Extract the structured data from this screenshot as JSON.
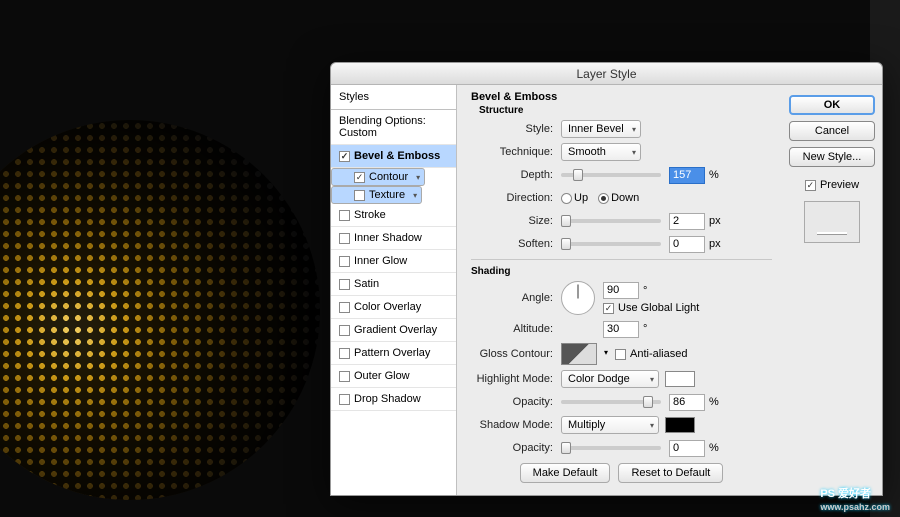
{
  "dialog": {
    "title": "Layer Style"
  },
  "styles_list": {
    "header": "Styles",
    "blending": "Blending Options: Custom",
    "items": [
      {
        "label": "Bevel & Emboss",
        "checked": true,
        "active": true
      },
      {
        "label": "Contour",
        "checked": true,
        "indent": true,
        "sel": true
      },
      {
        "label": "Texture",
        "checked": false,
        "indent": true,
        "sel": true
      },
      {
        "label": "Stroke",
        "checked": false
      },
      {
        "label": "Inner Shadow",
        "checked": false
      },
      {
        "label": "Inner Glow",
        "checked": false
      },
      {
        "label": "Satin",
        "checked": false
      },
      {
        "label": "Color Overlay",
        "checked": false
      },
      {
        "label": "Gradient Overlay",
        "checked": false
      },
      {
        "label": "Pattern Overlay",
        "checked": false
      },
      {
        "label": "Outer Glow",
        "checked": false
      },
      {
        "label": "Drop Shadow",
        "checked": false
      }
    ]
  },
  "bevel": {
    "section": "Bevel & Emboss",
    "structure": "Structure",
    "style_label": "Style:",
    "style_value": "Inner Bevel",
    "technique_label": "Technique:",
    "technique_value": "Smooth",
    "depth_label": "Depth:",
    "depth_value": "157",
    "depth_unit": "%",
    "direction_label": "Direction:",
    "dir_up": "Up",
    "dir_down": "Down",
    "size_label": "Size:",
    "size_value": "2",
    "size_unit": "px",
    "soften_label": "Soften:",
    "soften_value": "0",
    "soften_unit": "px",
    "shading": "Shading",
    "angle_label": "Angle:",
    "angle_value": "90",
    "angle_unit": "°",
    "global_light": "Use Global Light",
    "altitude_label": "Altitude:",
    "altitude_value": "30",
    "altitude_unit": "°",
    "gloss_label": "Gloss Contour:",
    "antialiased": "Anti-aliased",
    "highlight_label": "Highlight Mode:",
    "highlight_value": "Color Dodge",
    "h_opacity_label": "Opacity:",
    "h_opacity_value": "86",
    "h_opacity_unit": "%",
    "shadow_label": "Shadow Mode:",
    "shadow_value": "Multiply",
    "s_opacity_label": "Opacity:",
    "s_opacity_value": "0",
    "s_opacity_unit": "%",
    "make_default": "Make Default",
    "reset_default": "Reset to Default"
  },
  "buttons": {
    "ok": "OK",
    "cancel": "Cancel",
    "new_style": "New Style...",
    "preview": "Preview"
  },
  "watermark": {
    "main": "PS 爱好者",
    "sub": "www.psahz.com"
  }
}
